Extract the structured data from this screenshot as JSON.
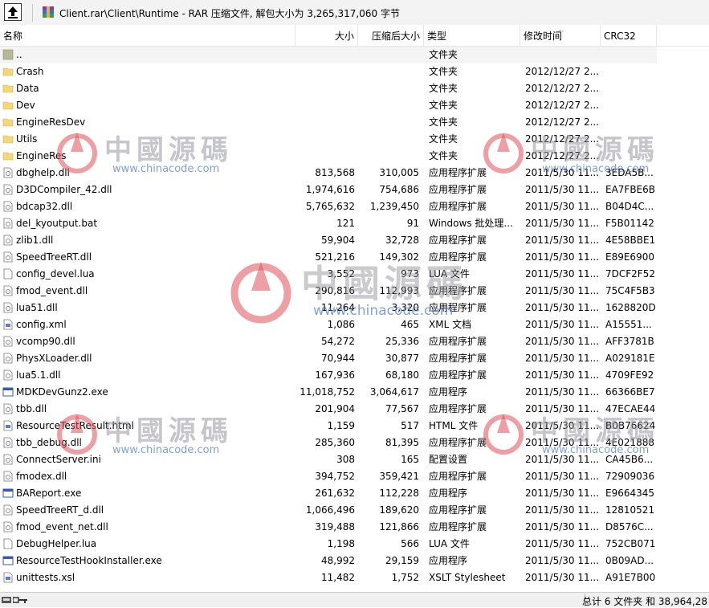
{
  "address": {
    "path": "Client.rar\\Client\\Runtime - RAR 压缩文件, 解包大小为 3,265,317,060 字节"
  },
  "columns": {
    "name": "名称",
    "size": "大小",
    "packed": "压缩后大小",
    "type": "类型",
    "modified": "修改时间",
    "crc": "CRC32"
  },
  "rows": [
    {
      "icon": "folder-up",
      "name": "..",
      "size": "",
      "packed": "",
      "type": "文件夹",
      "date": "",
      "crc": ""
    },
    {
      "icon": "folder",
      "name": "Crash",
      "size": "",
      "packed": "",
      "type": "文件夹",
      "date": "2012/12/27 2...",
      "crc": ""
    },
    {
      "icon": "folder",
      "name": "Data",
      "size": "",
      "packed": "",
      "type": "文件夹",
      "date": "2012/12/27 2...",
      "crc": ""
    },
    {
      "icon": "folder",
      "name": "Dev",
      "size": "",
      "packed": "",
      "type": "文件夹",
      "date": "2012/12/27 2...",
      "crc": ""
    },
    {
      "icon": "folder",
      "name": "EngineResDev",
      "size": "",
      "packed": "",
      "type": "文件夹",
      "date": "2012/12/27 2...",
      "crc": ""
    },
    {
      "icon": "folder",
      "name": "Utils",
      "size": "",
      "packed": "",
      "type": "文件夹",
      "date": "2012/12/27 2...",
      "crc": ""
    },
    {
      "icon": "folder",
      "name": "EngineRes",
      "size": "",
      "packed": "",
      "type": "文件夹",
      "date": "2012/12/27 2...",
      "crc": ""
    },
    {
      "icon": "dll",
      "name": "dbghelp.dll",
      "size": "813,568",
      "packed": "310,005",
      "type": "应用程序扩展",
      "date": "2011/5/30 11...",
      "crc": "3EDA5B..."
    },
    {
      "icon": "dll",
      "name": "D3DCompiler_42.dll",
      "size": "1,974,616",
      "packed": "754,686",
      "type": "应用程序扩展",
      "date": "2011/5/30 11...",
      "crc": "EA7FBE6B"
    },
    {
      "icon": "dll",
      "name": "bdcap32.dll",
      "size": "5,765,632",
      "packed": "1,239,450",
      "type": "应用程序扩展",
      "date": "2011/5/30 11...",
      "crc": "B04D4C..."
    },
    {
      "icon": "bat",
      "name": "del_kyoutput.bat",
      "size": "121",
      "packed": "91",
      "type": "Windows 批处理...",
      "date": "2011/5/30 11...",
      "crc": "F5B01142"
    },
    {
      "icon": "dll",
      "name": "zlib1.dll",
      "size": "59,904",
      "packed": "32,728",
      "type": "应用程序扩展",
      "date": "2011/5/30 11...",
      "crc": "4E58BBE1"
    },
    {
      "icon": "dll",
      "name": "SpeedTreeRT.dll",
      "size": "521,216",
      "packed": "149,302",
      "type": "应用程序扩展",
      "date": "2011/5/30 11...",
      "crc": "E89E6900"
    },
    {
      "icon": "file",
      "name": "config_devel.lua",
      "size": "3,552",
      "packed": "973",
      "type": "LUA 文件",
      "date": "2011/5/30 11...",
      "crc": "7DCF2F52"
    },
    {
      "icon": "dll",
      "name": "fmod_event.dll",
      "size": "290,816",
      "packed": "112,993",
      "type": "应用程序扩展",
      "date": "2011/5/30 11...",
      "crc": "75C4F5B3"
    },
    {
      "icon": "dll",
      "name": "lua51.dll",
      "size": "11,264",
      "packed": "3,320",
      "type": "应用程序扩展",
      "date": "2011/5/30 11...",
      "crc": "1628820D"
    },
    {
      "icon": "xml",
      "name": "config.xml",
      "size": "1,086",
      "packed": "465",
      "type": "XML 文档",
      "date": "2011/5/30 11...",
      "crc": "A15551..."
    },
    {
      "icon": "dll",
      "name": "vcomp90.dll",
      "size": "54,272",
      "packed": "25,336",
      "type": "应用程序扩展",
      "date": "2011/5/30 11...",
      "crc": "AFF3781B"
    },
    {
      "icon": "dll",
      "name": "PhysXLoader.dll",
      "size": "70,944",
      "packed": "30,877",
      "type": "应用程序扩展",
      "date": "2011/5/30 11...",
      "crc": "A029181E"
    },
    {
      "icon": "dll",
      "name": "lua5.1.dll",
      "size": "167,936",
      "packed": "68,180",
      "type": "应用程序扩展",
      "date": "2011/5/30 11...",
      "crc": "4709FE92"
    },
    {
      "icon": "exe",
      "name": "MDKDevGunz2.exe",
      "size": "11,018,752",
      "packed": "3,064,617",
      "type": "应用程序",
      "date": "2011/5/30 11...",
      "crc": "66366BE7"
    },
    {
      "icon": "dll",
      "name": "tbb.dll",
      "size": "201,904",
      "packed": "77,567",
      "type": "应用程序扩展",
      "date": "2011/5/30 11...",
      "crc": "47ECAE44"
    },
    {
      "icon": "html",
      "name": "ResourceTestResult.html",
      "size": "1,159",
      "packed": "517",
      "type": "HTML 文件",
      "date": "2011/5/30 11...",
      "crc": "B0B76624"
    },
    {
      "icon": "dll",
      "name": "tbb_debug.dll",
      "size": "285,360",
      "packed": "81,395",
      "type": "应用程序扩展",
      "date": "2011/5/30 11...",
      "crc": "4E021888"
    },
    {
      "icon": "ini",
      "name": "ConnectServer.ini",
      "size": "308",
      "packed": "165",
      "type": "配置设置",
      "date": "2011/5/30 11...",
      "crc": "CA45B6..."
    },
    {
      "icon": "dll",
      "name": "fmodex.dll",
      "size": "394,752",
      "packed": "359,421",
      "type": "应用程序扩展",
      "date": "2011/5/30 11...",
      "crc": "72909036"
    },
    {
      "icon": "exe",
      "name": "BAReport.exe",
      "size": "261,632",
      "packed": "112,228",
      "type": "应用程序",
      "date": "2011/5/30 11...",
      "crc": "E9664345"
    },
    {
      "icon": "dll",
      "name": "SpeedTreeRT_d.dll",
      "size": "1,066,496",
      "packed": "189,620",
      "type": "应用程序扩展",
      "date": "2011/5/30 11...",
      "crc": "12810521"
    },
    {
      "icon": "dll",
      "name": "fmod_event_net.dll",
      "size": "319,488",
      "packed": "121,866",
      "type": "应用程序扩展",
      "date": "2011/5/30 11...",
      "crc": "D8576C..."
    },
    {
      "icon": "file",
      "name": "DebugHelper.lua",
      "size": "1,198",
      "packed": "566",
      "type": "LUA 文件",
      "date": "2011/5/30 11...",
      "crc": "752CB071"
    },
    {
      "icon": "exe",
      "name": "ResourceTestHookInstaller.exe",
      "size": "48,992",
      "packed": "29,159",
      "type": "应用程序",
      "date": "2011/5/30 11...",
      "crc": "0B09AD..."
    },
    {
      "icon": "xsl",
      "name": "unittests.xsl",
      "size": "11,482",
      "packed": "1,752",
      "type": "XSLT Stylesheet",
      "date": "2011/5/30 11...",
      "crc": "A91E7B00"
    }
  ],
  "status": {
    "summary": "总计 6 文件夹 和 38,964,28"
  },
  "watermark": {
    "brand": "中國源碼",
    "url": "www.chinacode.com"
  },
  "colors": {
    "folder": "#f4d77a",
    "watermark_red": "#e0505a",
    "watermark_blue": "#4a78c8"
  }
}
